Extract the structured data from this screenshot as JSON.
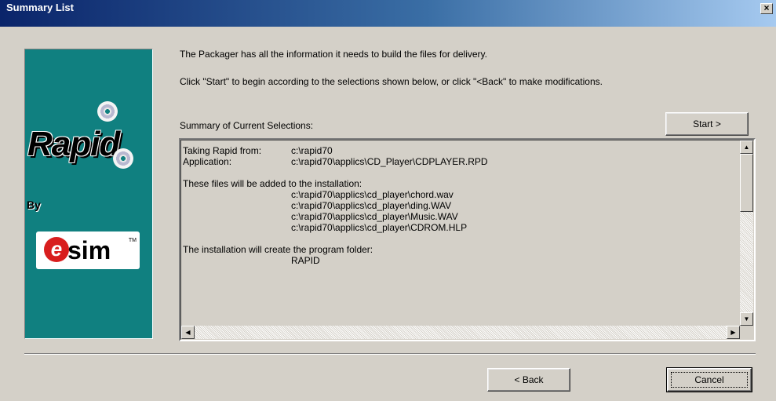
{
  "window": {
    "title": "Summary List",
    "close_label": "×"
  },
  "side_panel": {
    "logo_text": "Rapid",
    "by_text": "By",
    "company_logo": {
      "e": "e",
      "word": "sim",
      "tm": "TM"
    }
  },
  "messages": {
    "line1": "The Packager has all the information it needs to build the files for delivery.",
    "line2": "Click \"Start\" to begin according to the selections shown below, or click \"<Back\" to make modifications."
  },
  "summary": {
    "heading": "Summary of Current Selections:",
    "start_label": "Start >",
    "rows": [
      {
        "label": "Taking Rapid from:",
        "value": "c:\\rapid70"
      },
      {
        "label": "Application:",
        "value": "c:\\rapid70\\applics\\CD_Player\\CDPLAYER.RPD"
      }
    ],
    "files_heading": "These files will be added to the installation:",
    "files": [
      "c:\\rapid70\\applics\\cd_player\\chord.wav",
      "c:\\rapid70\\applics\\cd_player\\ding.WAV",
      "c:\\rapid70\\applics\\cd_player\\Music.WAV",
      "c:\\rapid70\\applics\\cd_player\\CDROM.HLP"
    ],
    "folder_heading": "The installation will create the program folder:",
    "folder": "RAPID"
  },
  "buttons": {
    "back_label": "< Back",
    "cancel_label": "Cancel"
  },
  "icons": [
    "close-icon",
    "cd-icon",
    "scroll-up-icon",
    "scroll-down-icon",
    "scroll-left-icon",
    "scroll-right-icon"
  ],
  "colors": {
    "titlebar_start": "#0a246a",
    "titlebar_end": "#a6caf0",
    "panel": "#108080",
    "face": "#d4d0c8"
  }
}
